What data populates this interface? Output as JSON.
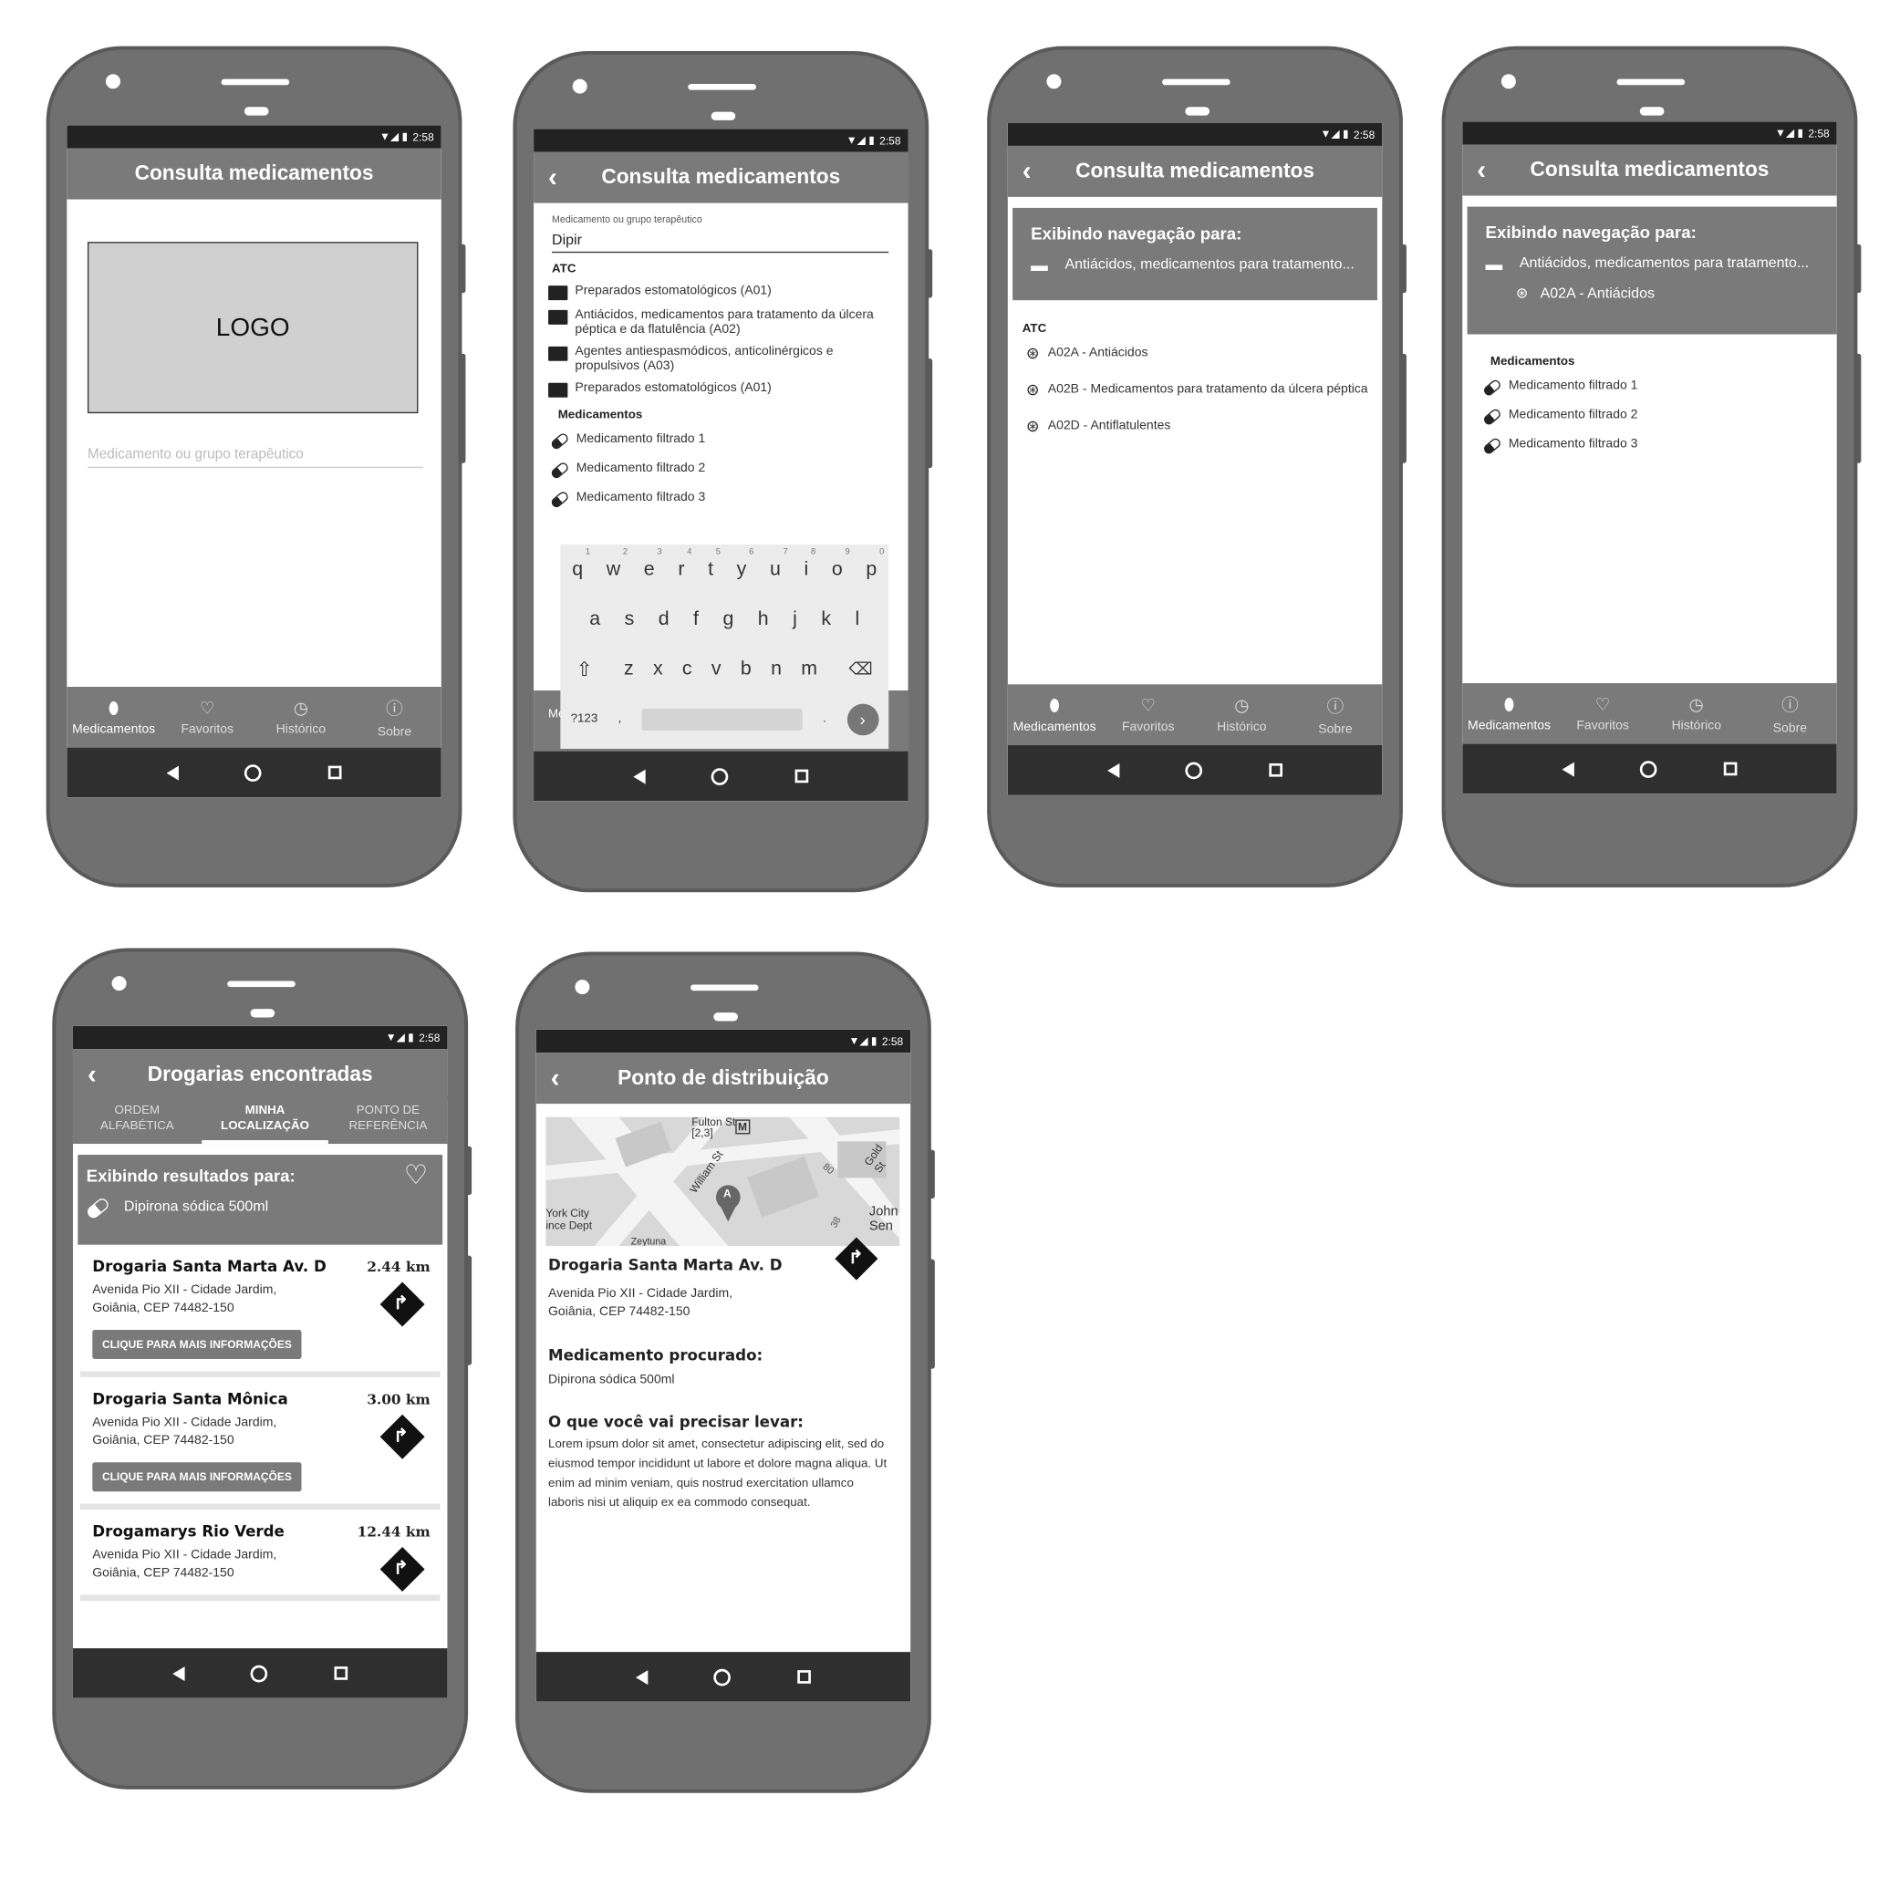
{
  "status": {
    "time": "2:58"
  },
  "bottom_nav": [
    {
      "label": "Medicamentos",
      "icon": "pill-icon"
    },
    {
      "label": "Favoritos",
      "icon": "heart-icon"
    },
    {
      "label": "Histórico",
      "icon": "clock-icon"
    },
    {
      "label": "Sobre",
      "icon": "info-icon"
    }
  ],
  "screen1": {
    "title": "Consulta medicamentos",
    "logo": "LOGO",
    "search_placeholder": "Medicamento ou grupo terapêutico"
  },
  "screen2": {
    "title": "Consulta medicamentos",
    "field_label": "Medicamento ou grupo terapêutico",
    "field_value": "Dipir",
    "atc_heading": "ATC",
    "atc_items": [
      "Preparados estomatológicos (A01)",
      "Antiácidos, medicamentos para tratamento da úlcera péptica e da flatulência (A02)",
      "Agentes antiespasmódicos, anticolinérgicos e propulsivos (A03)",
      "Preparados estomatológicos (A01)"
    ],
    "med_heading": "Medicamentos",
    "meds": [
      "Medicamento filtrado 1",
      "Medicamento filtrado 2",
      "Medicamento filtrado 3"
    ],
    "keyboard": {
      "row1": [
        "q",
        "w",
        "e",
        "r",
        "t",
        "y",
        "u",
        "i",
        "o",
        "p"
      ],
      "row1_nums": [
        "1",
        "2",
        "3",
        "4",
        "5",
        "6",
        "7",
        "8",
        "9",
        "0"
      ],
      "row2": [
        "a",
        "s",
        "d",
        "f",
        "g",
        "h",
        "j",
        "k",
        "l"
      ],
      "row3": [
        "z",
        "x",
        "c",
        "v",
        "b",
        "n",
        "m"
      ],
      "sym": "?123",
      "comma": ",",
      "period": "."
    }
  },
  "screen3": {
    "title": "Consulta medicamentos",
    "nav_heading": "Exibindo navegação para:",
    "nav_folder": "Antiácidos, medicamentos para tratamento...",
    "atc_heading": "ATC",
    "atc_items": [
      "A02A - Antiácidos",
      "A02B - Medicamentos para tratamento da úlcera péptica",
      "A02D - Antiflatulentes"
    ]
  },
  "screen4": {
    "title": "Consulta medicamentos",
    "nav_heading": "Exibindo navegação para:",
    "nav_folder": "Antiácidos, medicamentos para tratamento...",
    "nav_sub": "A02A - Antiácidos",
    "med_heading": "Medicamentos",
    "meds": [
      "Medicamento filtrado 1",
      "Medicamento filtrado 2",
      "Medicamento filtrado 3"
    ]
  },
  "screen5": {
    "title": "Drogarias encontradas",
    "tabs": [
      "ORDEM ALFABÉTICA",
      "MINHA LOCALIZAÇÃO",
      "PONTO DE REFERÊNCIA"
    ],
    "results_heading": "Exibindo resultados para:",
    "results_item": "Dipirona sódica 500ml",
    "more_label": "CLIQUE PARA MAIS INFORMAÇÕES",
    "pharmacies": [
      {
        "name": "Drogaria Santa Marta Av. D",
        "distance": "2.44 km",
        "addr1": "Avenida Pio XII - Cidade Jardim,",
        "addr2": "Goiânia, CEP 74482-150"
      },
      {
        "name": "Drogaria Santa Mônica",
        "distance": "3.00 km",
        "addr1": "Avenida Pio XII - Cidade Jardim,",
        "addr2": "Goiânia, CEP 74482-150"
      },
      {
        "name": "Drogamarys Rio Verde",
        "distance": "12.44 km",
        "addr1": "Avenida Pio XII - Cidade Jardim,",
        "addr2": "Goiânia, CEP 74482-150"
      }
    ]
  },
  "screen6": {
    "title": "Ponto de distribuição",
    "name": "Drogaria Santa Marta Av. D",
    "addr1": "Avenida Pio XII - Cidade Jardim,",
    "addr2": "Goiânia, CEP 74482-150",
    "med_heading": "Medicamento procurado:",
    "med_value": "Dipirona sódica 500ml",
    "need_heading": "O que você vai precisar levar:",
    "need_text": "Lorem ipsum dolor sit amet, consectetur adipiscing elit, sed do eiusmod tempor incididunt ut labore et dolore magna aliqua. Ut enim ad minim veniam, quis nostrud exercitation ullamco laboris nisi ut aliquip ex ea commodo consequat.",
    "map_labels": [
      "Fulton St [2,3]",
      "M",
      "William St",
      "80",
      "Gold St",
      "A",
      "York City ince Dept",
      "Zeytuna",
      "John Sen",
      "38"
    ]
  }
}
